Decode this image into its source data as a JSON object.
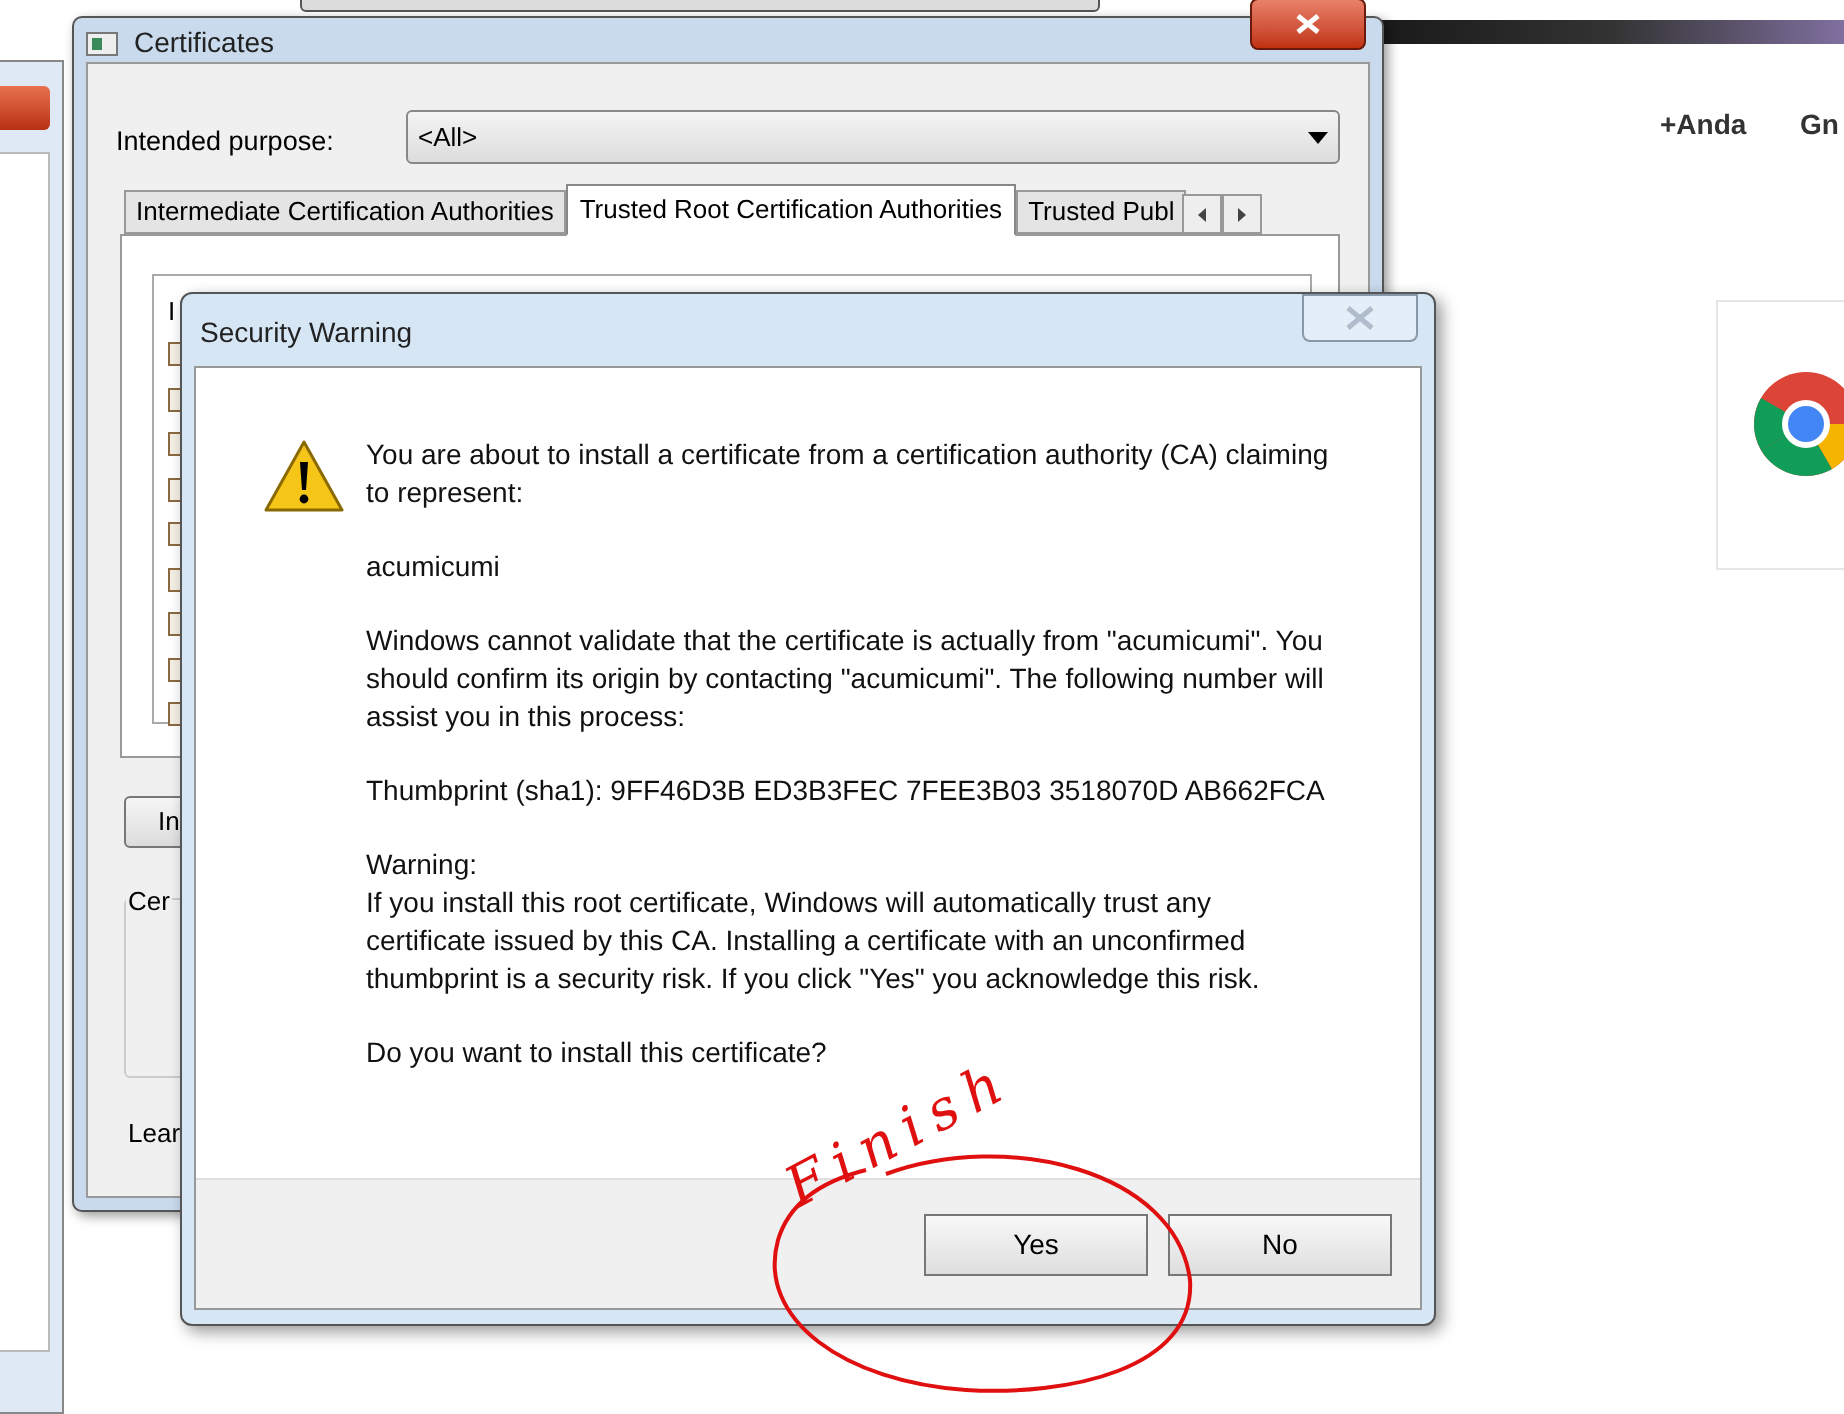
{
  "browser": {
    "profile_link": "+Anda",
    "nav_link": "Gn"
  },
  "certificates_window": {
    "title": "Certificates",
    "purpose_label": "Intended purpose:",
    "purpose_value": "<All>",
    "tabs": [
      {
        "label": "Intermediate Certification Authorities",
        "selected": false
      },
      {
        "label": "Trusted Root Certification Authorities",
        "selected": true
      },
      {
        "label": "Trusted Publ",
        "selected": false
      }
    ],
    "list_header": "I",
    "import_button": "In",
    "group_label": "Cer",
    "learn_link": "Lear"
  },
  "security_warning": {
    "title": "Security Warning",
    "paragraphs": [
      "You are about to install a certificate from a certification authority (CA) claiming to represent:",
      "acumicumi",
      "Windows cannot validate that the certificate is actually from \"acumicumi\". You should confirm its origin by contacting \"acumicumi\". The following number will assist you in this process:",
      "Thumbprint (sha1): 9FF46D3B ED3B3FEC 7FEE3B03 3518070D AB662FCA",
      "Warning:\nIf you install this root certificate, Windows will automatically trust any certificate issued by this CA. Installing a certificate with an unconfirmed thumbprint is a security risk. If you click \"Yes\" you acknowledge this risk.",
      "Do you want to install this certificate?"
    ],
    "buttons": [
      "Yes",
      "No"
    ]
  },
  "annotation": {
    "text": "Finish"
  }
}
